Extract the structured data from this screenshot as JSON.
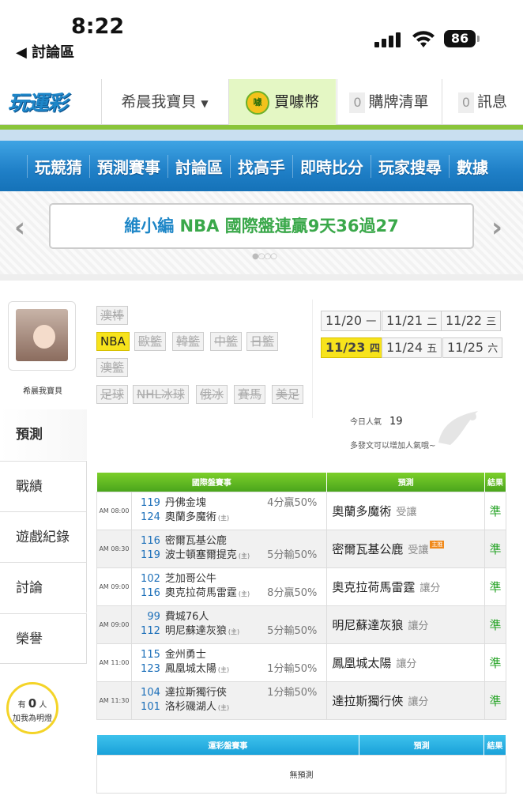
{
  "status": {
    "time": "8:22",
    "back_label": "◀ 討論區",
    "battery": "86"
  },
  "topnav": {
    "logo": "玩運彩",
    "user": "希晨我寶貝",
    "buy_coin_icon_text": "噱",
    "buy": "買噱幣",
    "cart_count": "0",
    "cart": "購牌清單",
    "msg_count": "0",
    "msg": "訊息"
  },
  "mainnav": [
    "玩競猜",
    "預測賽事",
    "討論區",
    "找高手",
    "即時比分",
    "玩家搜尋",
    "數據"
  ],
  "banner": {
    "text_blue": "維小編 ",
    "text_green": "NBA 國際盤連贏9天36過27"
  },
  "sidebar": {
    "username": "希晨我寶貝",
    "items": [
      "預測",
      "戰績",
      "遊戲紀錄",
      "討論",
      "榮譽"
    ],
    "bulb": {
      "prefix": "有",
      "count": "0",
      "suffix": "人",
      "line2": "加我為明燈"
    }
  },
  "leagues": [
    "澳棒",
    "NBA",
    "歐籃",
    "韓籃",
    "中籃",
    "日籃",
    "澳籃",
    "足球",
    "NHL冰球",
    "俄冰",
    "賽馬",
    "美足"
  ],
  "dates": [
    {
      "d": "11/20",
      "w": "一"
    },
    {
      "d": "11/21",
      "w": "二"
    },
    {
      "d": "11/22",
      "w": "三"
    },
    {
      "d": "11/23",
      "w": "四"
    },
    {
      "d": "11/24",
      "w": "五"
    },
    {
      "d": "11/25",
      "w": "六"
    }
  ],
  "popularity": {
    "label": "今日人氣",
    "value": "19",
    "hint": "多發文可以增加人氣哦~"
  },
  "intl_table": {
    "headers": [
      "國際盤賽事",
      "預測",
      "結果"
    ],
    "host_mark": "(主)",
    "rows": [
      {
        "time": "AM 08:00",
        "n1": "119",
        "t1": "丹佛金塊",
        "n2": "124",
        "t2": "奧蘭多魔術",
        "odd1": "4分贏50%",
        "odd2": "",
        "pred": "奧蘭多魔術",
        "ptype": "受讓",
        "tag": "",
        "result": "準"
      },
      {
        "time": "AM 08:30",
        "n1": "116",
        "t1": "密爾瓦基公鹿",
        "n2": "119",
        "t2": "波士頓塞爾提克",
        "odd1": "",
        "odd2": "5分輸50%",
        "pred": "密爾瓦基公鹿",
        "ptype": "受讓",
        "tag": "主推",
        "result": "準"
      },
      {
        "time": "AM 09:00",
        "n1": "102",
        "t1": "芝加哥公牛",
        "n2": "116",
        "t2": "奧克拉荷馬雷霆",
        "odd1": "",
        "odd2": "8分贏50%",
        "pred": "奧克拉荷馬雷霆",
        "ptype": "讓分",
        "tag": "",
        "result": "準"
      },
      {
        "time": "AM 09:00",
        "n1": "99",
        "t1": "費城76人",
        "n2": "112",
        "t2": "明尼蘇達灰狼",
        "odd1": "",
        "odd2": "5分輸50%",
        "pred": "明尼蘇達灰狼",
        "ptype": "讓分",
        "tag": "",
        "result": "準"
      },
      {
        "time": "AM 11:00",
        "n1": "115",
        "t1": "金州勇士",
        "n2": "123",
        "t2": "鳳凰城太陽",
        "odd1": "",
        "odd2": "1分輸50%",
        "pred": "鳳凰城太陽",
        "ptype": "讓分",
        "tag": "",
        "result": "準"
      },
      {
        "time": "AM 11:30",
        "n1": "104",
        "t1": "達拉斯獨行俠",
        "n2": "101",
        "t2": "洛杉磯湖人",
        "odd1": "1分輸50%",
        "odd2": "",
        "pred": "達拉斯獨行俠",
        "ptype": "讓分",
        "tag": "",
        "result": "準"
      }
    ]
  },
  "lottery_table": {
    "headers": [
      "運彩盤賽事",
      "預測",
      "結果"
    ],
    "empty": "無預測"
  },
  "colors": {
    "brand_blue": "#1f7fc7",
    "brand_green": "#5cb52a",
    "select_yellow": "#f7e31c",
    "result_green": "#2aa52a"
  }
}
